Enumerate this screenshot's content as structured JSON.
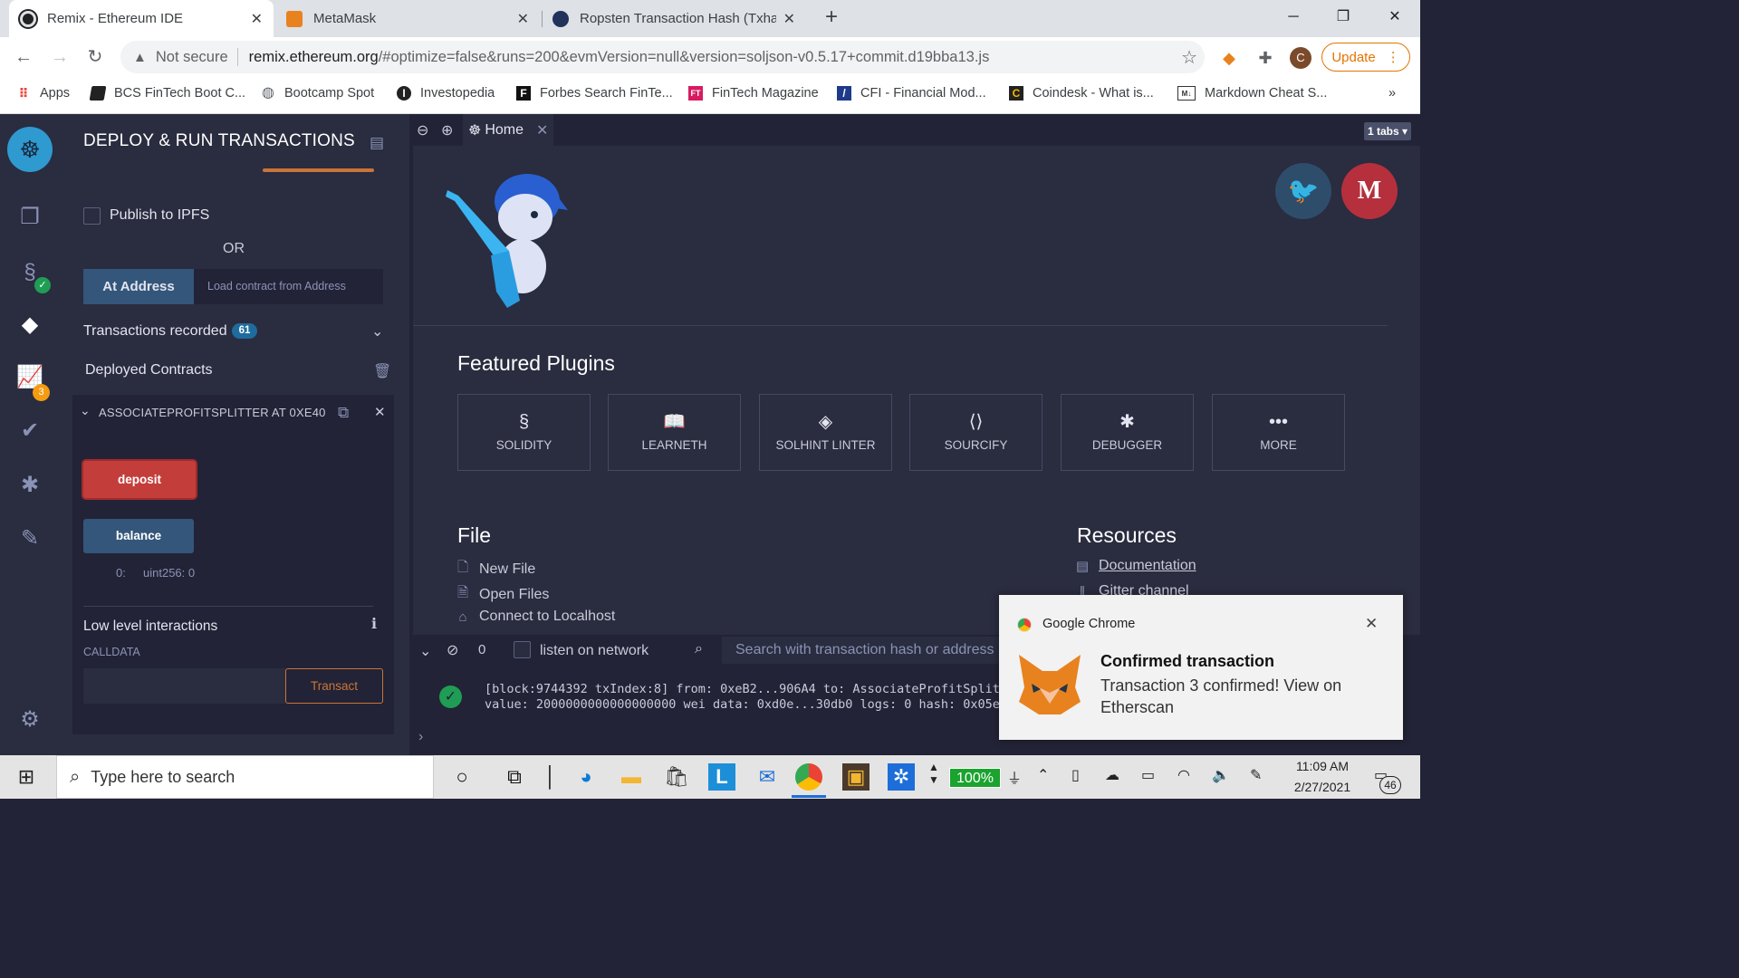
{
  "browser": {
    "tabs": [
      {
        "title": "Remix - Ethereum IDE",
        "active": true
      },
      {
        "title": "MetaMask",
        "active": false
      },
      {
        "title": "Ropsten Transaction Hash (Txhas",
        "active": false
      }
    ],
    "url_security": "Not secure",
    "url_host": "remix.ethereum.org",
    "url_path": "/#optimize=false&runs=200&evmVersion=null&version=soljson-v0.5.17+commit.d19bba13.js",
    "avatar_letter": "C",
    "update_label": "Update",
    "bookmarks": [
      "Apps",
      "BCS FinTech Boot C...",
      "Bootcamp Spot",
      "Investopedia",
      "Forbes Search FinTe...",
      "FinTech Magazine",
      "CFI - Financial Mod...",
      "Coindesk - What is...",
      "Markdown Cheat S..."
    ],
    "bookmarks_overflow": "»"
  },
  "remix": {
    "icon_panel": {
      "compile_badge": "3"
    },
    "side_panel": {
      "title": "DEPLOY & RUN TRANSACTIONS",
      "publish_ipfs_label": "Publish to IPFS",
      "or_label": "OR",
      "at_address_label": "At Address",
      "load_address_placeholder": "Load contract from Address",
      "transactions_recorded_label": "Transactions recorded",
      "transactions_recorded_count": "61",
      "deployed_contracts_label": "Deployed Contracts",
      "contract_instance_label": "ASSOCIATEPROFITSPLITTER AT 0XE40",
      "deposit_label": "deposit",
      "balance_label": "balance",
      "balance_result_index": "0:",
      "balance_result_value": "uint256: 0",
      "low_level_label": "Low level interactions",
      "calldata_label": "CALLDATA",
      "transact_label": "Transact"
    },
    "editor": {
      "home_tab_label": "Home",
      "tabs_count_label": "1 tabs ▾"
    },
    "home": {
      "featured_title": "Featured Plugins",
      "plugins": [
        {
          "label": "SOLIDITY",
          "icon": "solidity-icon"
        },
        {
          "label": "LEARNETH",
          "icon": "learneth-icon"
        },
        {
          "label": "SOLHINT LINTER",
          "icon": "solhint-icon"
        },
        {
          "label": "SOURCIFY",
          "icon": "sourcify-icon"
        },
        {
          "label": "DEBUGGER",
          "icon": "debugger-icon"
        },
        {
          "label": "MORE",
          "icon": "more-icon"
        }
      ],
      "file_title": "File",
      "file_links": [
        "New File",
        "Open Files",
        "Connect to Localhost"
      ],
      "resources_title": "Resources",
      "resource_links": [
        "Documentation",
        "Gitter channel"
      ]
    },
    "terminal": {
      "pending_count": "0",
      "listen_label": "listen on network",
      "search_placeholder": "Search with transaction hash or address",
      "log_line1": "[block:9744392 txIndex:8] from: 0xeB2...906A4 to: AssociateProfitSplitter",
      "log_line2": "value: 2000000000000000000 wei data: 0xd0e...30db0 logs: 0 hash: 0x05e..."
    }
  },
  "notification": {
    "app": "Google Chrome",
    "title": "Confirmed transaction",
    "body": "Transaction 3 confirmed! View on Etherscan"
  },
  "taskbar": {
    "search_placeholder": "Type here to search",
    "battery": "100%",
    "time": "11:09 AM",
    "date": "2/27/2021",
    "notifications_count": "46"
  },
  "colors": {
    "remix_bg": "#2a2c3f",
    "remix_dark": "#222336",
    "deposit_red": "#c33e3b",
    "button_blue": "#34567a",
    "transact_orange": "#c97539",
    "chrome_update": "#e37400"
  }
}
